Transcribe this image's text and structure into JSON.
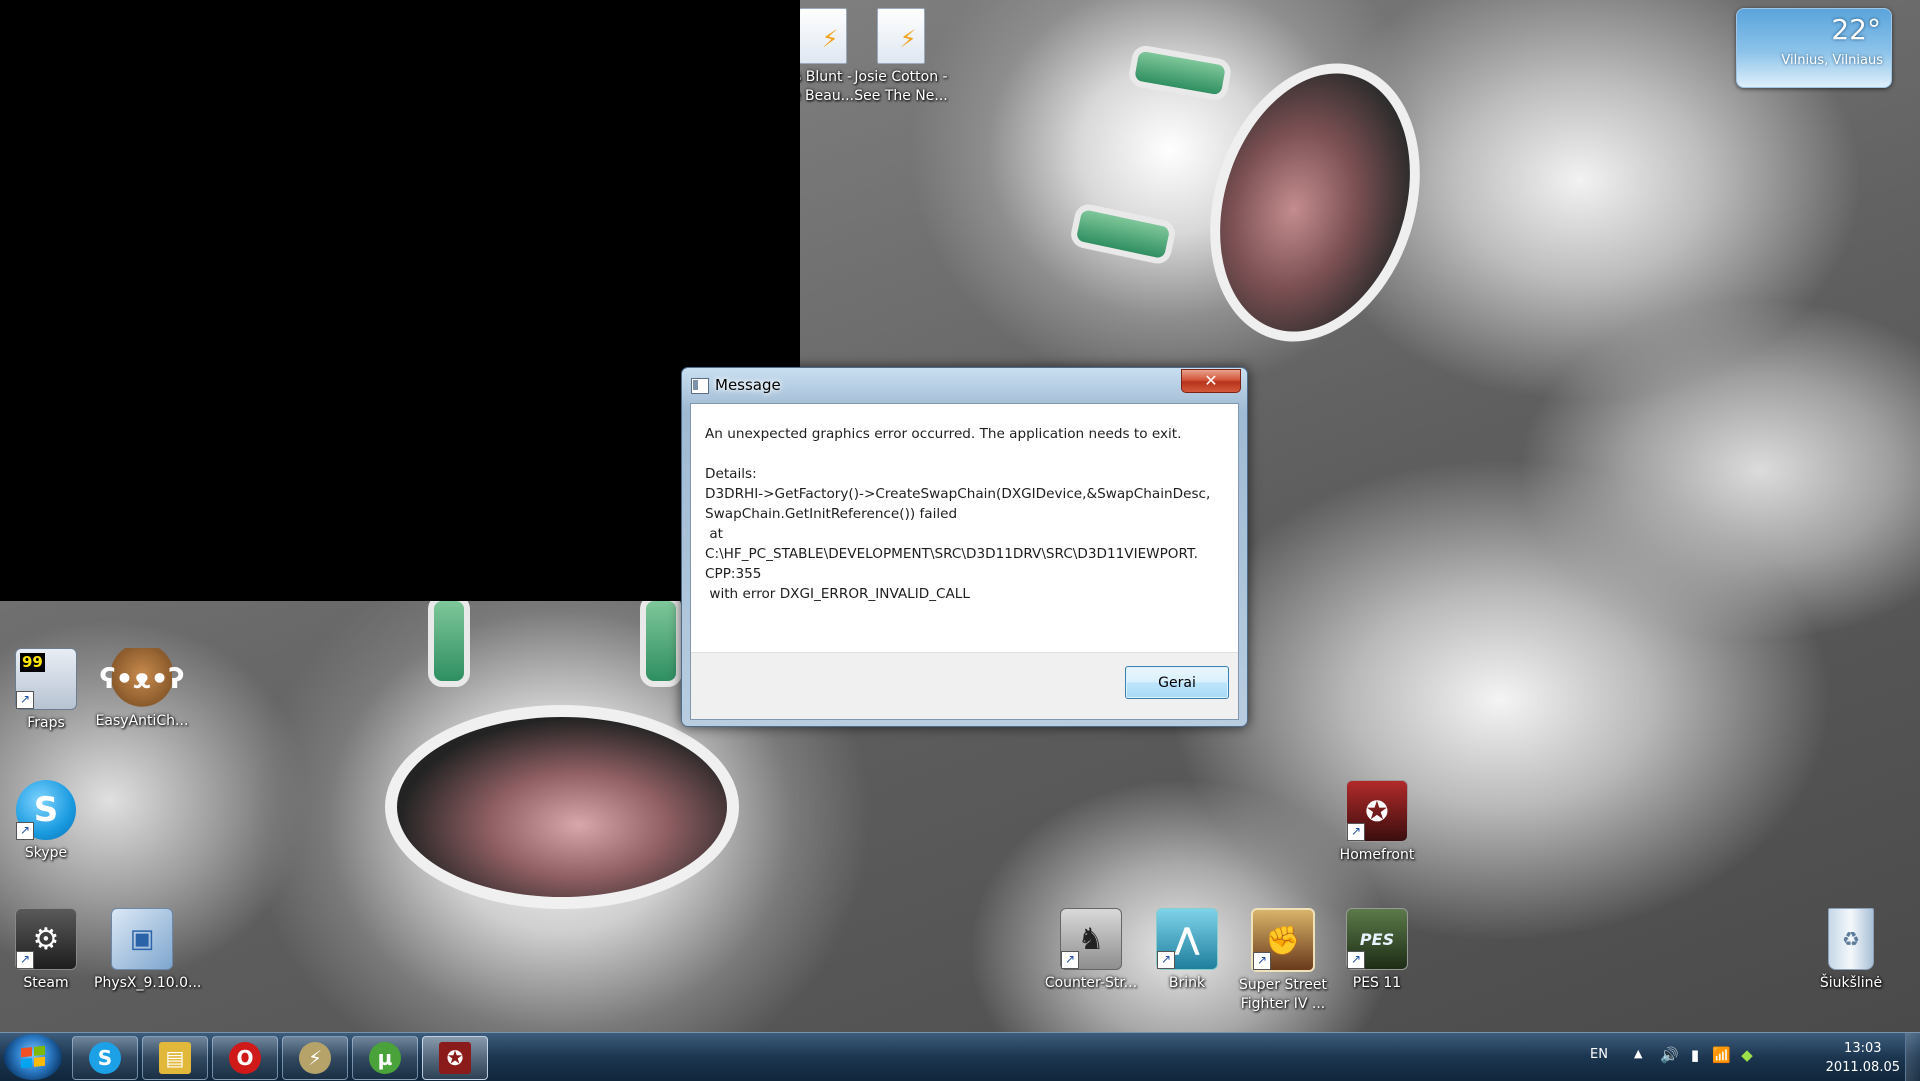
{
  "weather": {
    "temperature": "22°",
    "location": "Vilnius, Vilniaus"
  },
  "desktop_icons": {
    "james_blunt": {
      "label_line1": "s Blunt -",
      "label_line2": "e Beau..."
    },
    "josie_cotton": {
      "label_line1": "Josie Cotton -",
      "label_line2": "See The Ne..."
    },
    "fraps": {
      "label": "Fraps",
      "badge": "99"
    },
    "easyanticheat": {
      "label": "EasyAntiCh..."
    },
    "skype": {
      "label": "Skype"
    },
    "steam": {
      "label": "Steam"
    },
    "physx": {
      "label": "PhysX_9.10.0..."
    },
    "homefront": {
      "label": "Homefront"
    },
    "counter_strike": {
      "label": "Counter-Str..."
    },
    "brink": {
      "label": "Brink"
    },
    "sf4": {
      "label_line1": "Super Street",
      "label_line2": "Fighter IV ..."
    },
    "pes11": {
      "label": "PES 11",
      "badge": "PES"
    },
    "recycle_bin": {
      "label": "Šiukšlinė"
    }
  },
  "dialog": {
    "title": "Message",
    "close_label": "✕",
    "message": "An unexpected graphics error occurred. The application needs to exit.\n\nDetails:\nD3DRHI->GetFactory()->CreateSwapChain(DXGIDevice,&SwapChainDesc,\nSwapChain.GetInitReference()) failed\n at\nC:\\HF_PC_STABLE\\DEVELOPMENT\\SRC\\D3D11DRV\\SRC\\D3D11VIEWPORT.\nCPP:355\n with error DXGI_ERROR_INVALID_CALL",
    "ok_label": "Gerai"
  },
  "taskbar": {
    "pinned": [
      {
        "name": "skype",
        "glyph": "S",
        "color": "#1da1e6"
      },
      {
        "name": "explorer",
        "glyph": "▤",
        "color": "#e2b83a"
      },
      {
        "name": "opera",
        "glyph": "O",
        "color": "#d01a1a"
      },
      {
        "name": "winamp",
        "glyph": "⚡",
        "color": "#b5a36a"
      },
      {
        "name": "utorrent",
        "glyph": "µ",
        "color": "#4aa23a"
      },
      {
        "name": "homefront",
        "glyph": "✪",
        "color": "#8b1b1b"
      }
    ]
  },
  "tray": {
    "language": "EN",
    "show_hidden": "▲",
    "volume": "🔊",
    "network": "📶",
    "time": "13:03",
    "date": "2011.08.05"
  },
  "colors": {
    "taskbar": "#1c3650",
    "dialog_ok_border": "#3c7fb1",
    "close_button": "#c7412a"
  }
}
